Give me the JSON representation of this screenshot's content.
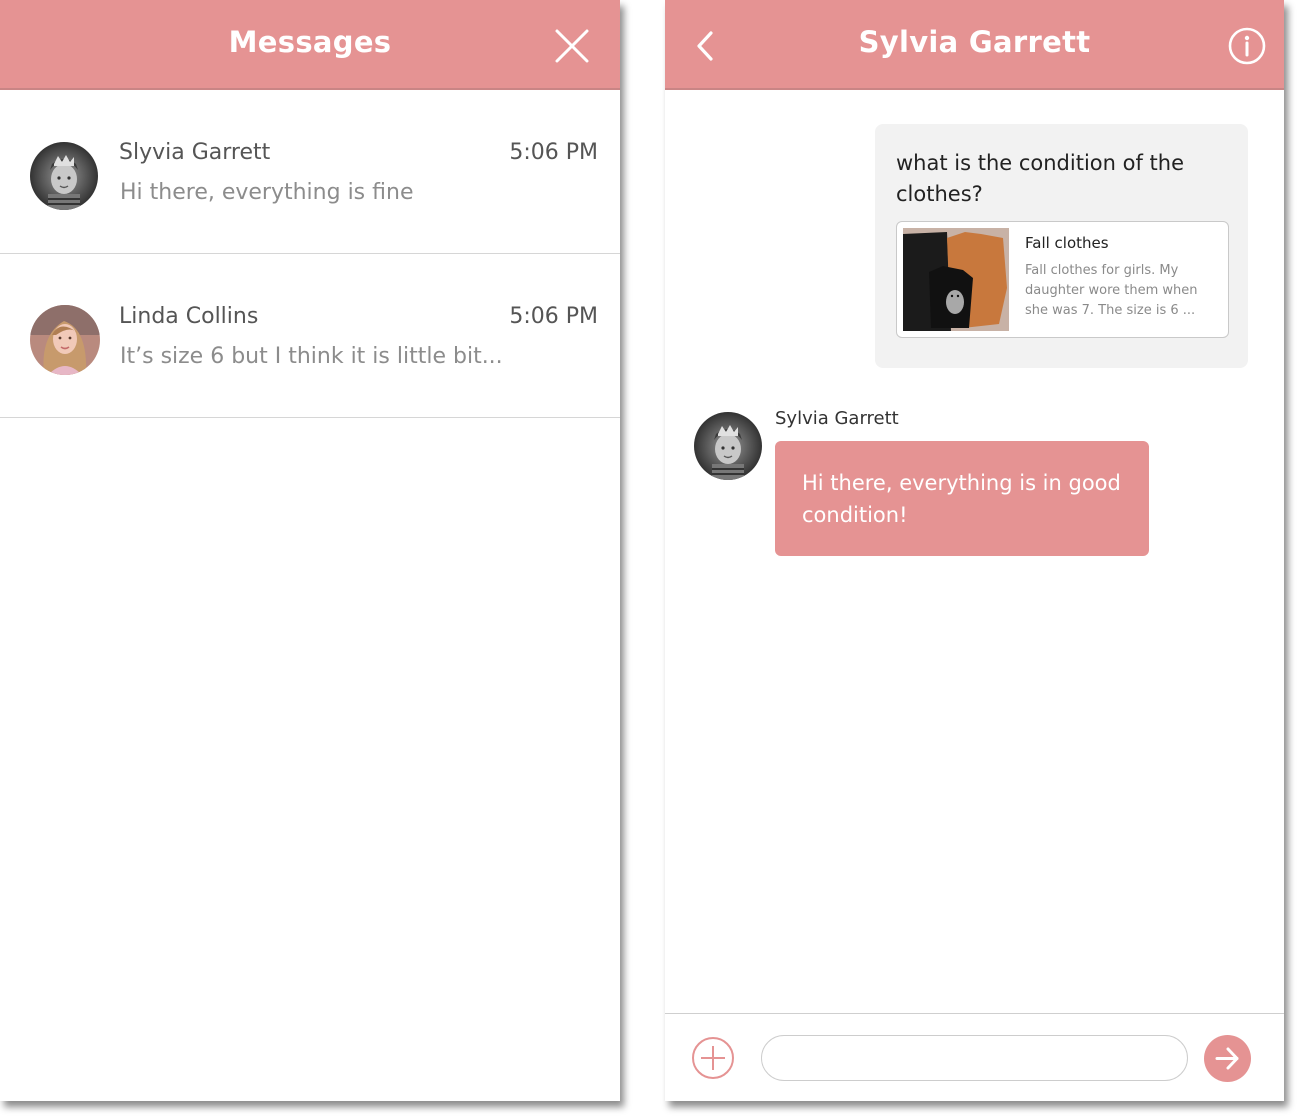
{
  "colors": {
    "accent": "#e59393",
    "bubble_gray": "#f2f2f2",
    "divider": "#d6d6d6"
  },
  "messages_screen": {
    "title": "Messages",
    "close_icon": "close-icon",
    "conversations": [
      {
        "name": "Slyvia Garrett",
        "time": "5:06 PM",
        "preview": "Hi there, everything is fine",
        "avatar": "avatar-bw"
      },
      {
        "name": "Linda Collins",
        "time": "5:06 PM",
        "preview": "It’s size 6 but I think it is little bit...",
        "avatar": "avatar-color"
      }
    ]
  },
  "chat_screen": {
    "title": "Sylvia Garrett",
    "back_icon": "chevron-left-icon",
    "info_icon": "info-icon",
    "outgoing_message": {
      "text": "what is the condition of the clothes?",
      "listing": {
        "title": "Fall clothes",
        "description": "Fall clothes for girls. My daughter wore them when she was 7. The size is 6 ..."
      }
    },
    "incoming_message": {
      "sender": "Sylvia Garrett",
      "text": "Hi there, everything is in good condition!"
    },
    "composer": {
      "input_value": "",
      "input_placeholder": "",
      "add_icon": "plus-circle-icon",
      "send_icon": "arrow-right-icon"
    }
  }
}
